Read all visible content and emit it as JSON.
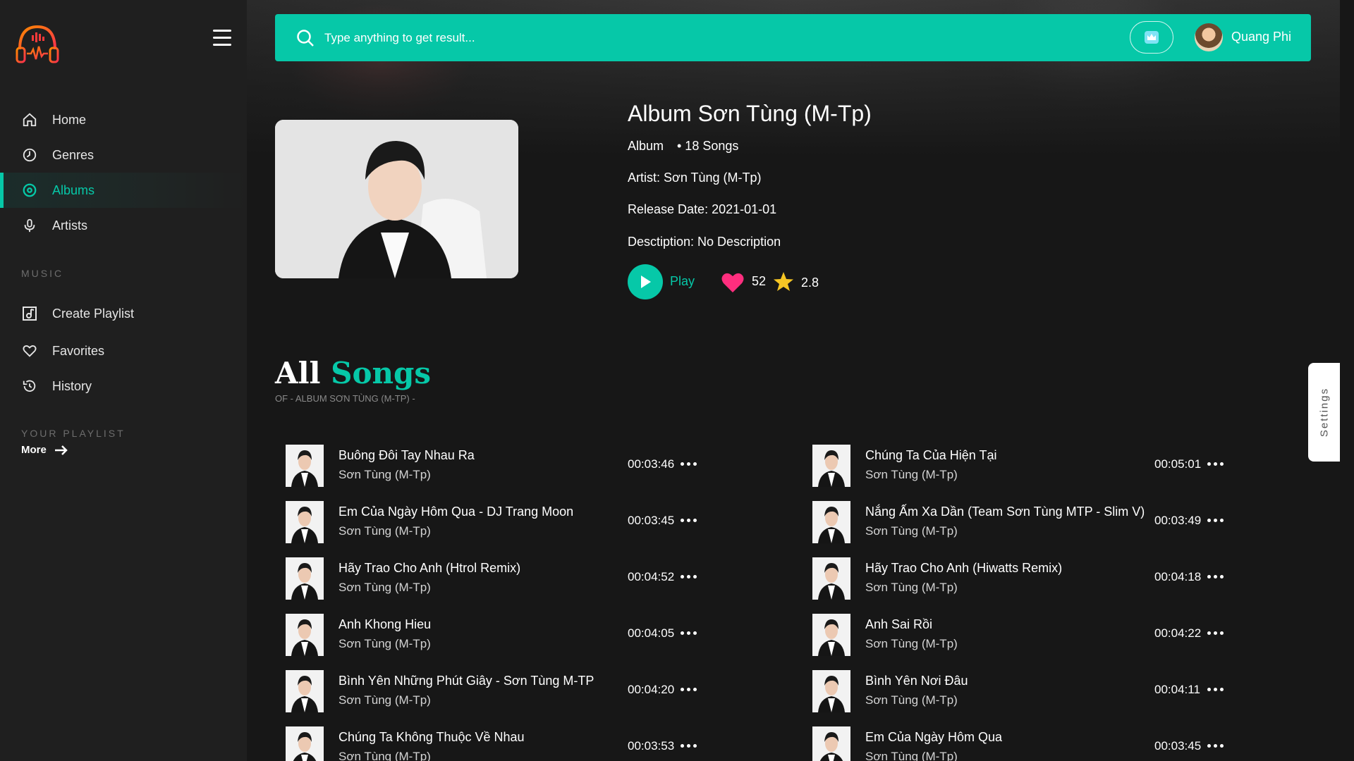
{
  "sidebar": {
    "nav": [
      {
        "label": "Home",
        "icon": "home-icon"
      },
      {
        "label": "Genres",
        "icon": "genres-icon"
      },
      {
        "label": "Albums",
        "icon": "albums-icon"
      },
      {
        "label": "Artists",
        "icon": "microphone-icon"
      }
    ],
    "music_section": "MUSIC",
    "music": [
      {
        "label": "Create Playlist",
        "icon": "playlist-icon"
      },
      {
        "label": "Favorites",
        "icon": "heart-outline-icon"
      },
      {
        "label": "History",
        "icon": "history-icon"
      }
    ],
    "playlist_section": "YOUR PLAYLIST",
    "more_label": "More",
    "active": "Albums"
  },
  "search": {
    "placeholder": "Type anything to get result..."
  },
  "user": {
    "name": "Quang Phi"
  },
  "album": {
    "title": "Album Sơn Tùng (M-Tp)",
    "type": "Album",
    "songs": "• 18 Songs",
    "artist": "Artist: Sơn Tùng (M-Tp)",
    "release": "Release Date: 2021-01-01",
    "description": "Desctiption: No Description",
    "play_label": "Play",
    "likes": "52",
    "rating": "2.8"
  },
  "section": {
    "all": "All",
    "songs": "Songs",
    "of": "OF - ALBUM SƠN TÙNG (M-TP) -"
  },
  "songs_left": [
    {
      "title": "Buông Đôi Tay Nhau Ra",
      "artist": "Sơn Tùng (M-Tp)",
      "duration": "00:03:46"
    },
    {
      "title": "Em Của Ngày Hôm Qua - DJ Trang Moon",
      "artist": "Sơn Tùng (M-Tp)",
      "duration": "00:03:45"
    },
    {
      "title": "Hãy Trao Cho Anh (Htrol Remix)",
      "artist": "Sơn Tùng (M-Tp)",
      "duration": "00:04:52"
    },
    {
      "title": "Anh Khong Hieu",
      "artist": "Sơn Tùng (M-Tp)",
      "duration": "00:04:05"
    },
    {
      "title": "Bình Yên Những Phút Giây - Sơn Tùng M-TP",
      "artist": "Sơn Tùng (M-Tp)",
      "duration": "00:04:20"
    },
    {
      "title": "Chúng Ta Không Thuộc Về Nhau",
      "artist": "Sơn Tùng (M-Tp)",
      "duration": "00:03:53"
    }
  ],
  "songs_right": [
    {
      "title": "Chúng Ta Của Hiện Tại",
      "artist": "Sơn Tùng (M-Tp)",
      "duration": "00:05:01"
    },
    {
      "title": "Nắng Ấm Xa Dần (Team Sơn Tùng MTP - Slim V)",
      "artist": "Sơn Tùng (M-Tp)",
      "duration": "00:03:49"
    },
    {
      "title": "Hãy Trao Cho Anh (Hiwatts Remix)",
      "artist": "Sơn Tùng (M-Tp)",
      "duration": "00:04:18"
    },
    {
      "title": "Anh Sai Rồi",
      "artist": "Sơn Tùng (M-Tp)",
      "duration": "00:04:22"
    },
    {
      "title": "Bình Yên Nơi Đâu",
      "artist": "Sơn Tùng (M-Tp)",
      "duration": "00:04:11"
    },
    {
      "title": "Em Của Ngày Hôm Qua",
      "artist": "Sơn Tùng (M-Tp)",
      "duration": "00:03:45"
    }
  ],
  "settings_label": "Settings",
  "colors": {
    "accent": "#06c8a8",
    "sidebar": "#1f1f1f",
    "background": "#171717",
    "heart": "#ff2e7e",
    "star": "#f6c624"
  }
}
